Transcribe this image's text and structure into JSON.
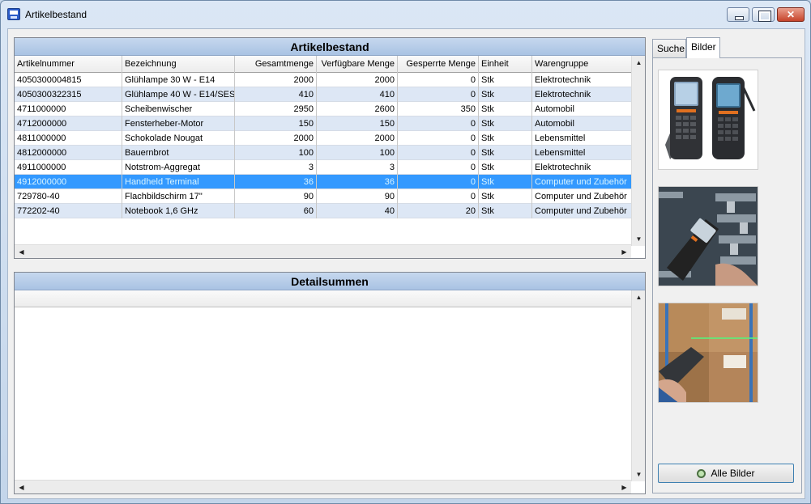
{
  "window": {
    "title": "Artikelbestand"
  },
  "artikel": {
    "header": "Artikelbestand",
    "columns": [
      "Artikelnummer",
      "Bezeichnung",
      "Gesamtmenge",
      "Verfügbare Menge",
      "Gesperrte Menge",
      "Einheit",
      "Warengruppe"
    ],
    "rows": [
      [
        "4050300004815",
        "Glühlampe 30 W - E14",
        "2000",
        "2000",
        "0",
        "Stk",
        "Elektrotechnik"
      ],
      [
        "4050300322315",
        "Glühlampe 40 W - E14/SES",
        "410",
        "410",
        "0",
        "Stk",
        "Elektrotechnik"
      ],
      [
        "4711000000",
        "Scheibenwischer",
        "2950",
        "2600",
        "350",
        "Stk",
        "Automobil"
      ],
      [
        "4712000000",
        "Fensterheber-Motor",
        "150",
        "150",
        "0",
        "Stk",
        "Automobil"
      ],
      [
        "4811000000",
        "Schokolade Nougat",
        "2000",
        "2000",
        "0",
        "Stk",
        "Lebensmittel"
      ],
      [
        "4812000000",
        "Bauernbrot",
        "100",
        "100",
        "0",
        "Stk",
        "Lebensmittel"
      ],
      [
        "4911000000",
        "Notstrom-Aggregat",
        "3",
        "3",
        "0",
        "Stk",
        "Elektrotechnik"
      ],
      [
        "4912000000",
        "Handheld Terminal",
        "36",
        "36",
        "0",
        "Stk",
        "Computer und Zubehör"
      ],
      [
        "729780-40",
        "Flachbildschirm 17''",
        "90",
        "90",
        "0",
        "Stk",
        "Computer und Zubehör"
      ],
      [
        "772202-40",
        "Notebook 1,6 GHz",
        "60",
        "40",
        "20",
        "Stk",
        "Computer und Zubehör"
      ]
    ],
    "selected_row": 7
  },
  "detail": {
    "header": "Detailsummen"
  },
  "tabs": {
    "suche": "Suche",
    "bilder": "Bilder",
    "active": "bilder"
  },
  "images": [
    "handheld-terminals-product",
    "handheld-terminal-warehouse-shelf",
    "handheld-terminal-barcode-scan-boxes"
  ],
  "buttons": {
    "alle_bilder": "Alle Bilder"
  },
  "colors": {
    "selection": "#3399ff",
    "alt_row": "#dde7f5",
    "header": "#b8cfeb"
  }
}
